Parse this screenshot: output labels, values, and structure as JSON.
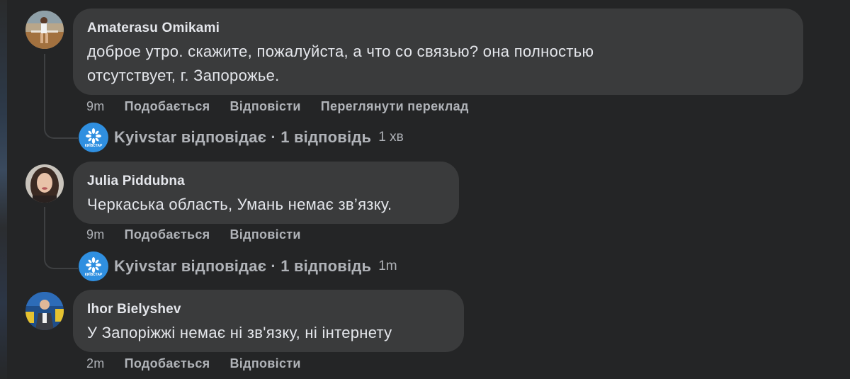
{
  "comments": [
    {
      "author": "Amaterasu Omikami",
      "text_line1": "доброе утро. скажите, пожалуйста, а что со связью? она полностью",
      "text_line2": "отсутствует, г. Запорожье.",
      "time": "9m",
      "like": "Подобається",
      "reply": "Відповісти",
      "translate": "Переглянути переклад",
      "reply_summary": {
        "label": "Kyivstar відповідає · 1 відповідь",
        "time": "1 хв",
        "avatar_text": "КИЇВСТАР"
      }
    },
    {
      "author": "Julia Piddubna",
      "text": "Черкаська область, Умань немає зв’язку.",
      "time": "9m",
      "like": "Подобається",
      "reply": "Відповісти",
      "reply_summary": {
        "label": "Kyivstar відповідає · 1 відповідь",
        "time": "1m",
        "avatar_text": "КИЇВСТАР"
      }
    },
    {
      "author": "Ihor Bielyshev",
      "text": "У Запоріжжі немає ні зв'язку, ні інтернету",
      "time": "2m",
      "like": "Подобається",
      "reply": "Відповісти"
    }
  ],
  "colors": {
    "background": "#242526",
    "bubble": "#3a3b3c",
    "primary_text": "#e4e6eb",
    "secondary_text": "#b0b3b8",
    "kyivstar_blue": "#2f8fe0"
  }
}
